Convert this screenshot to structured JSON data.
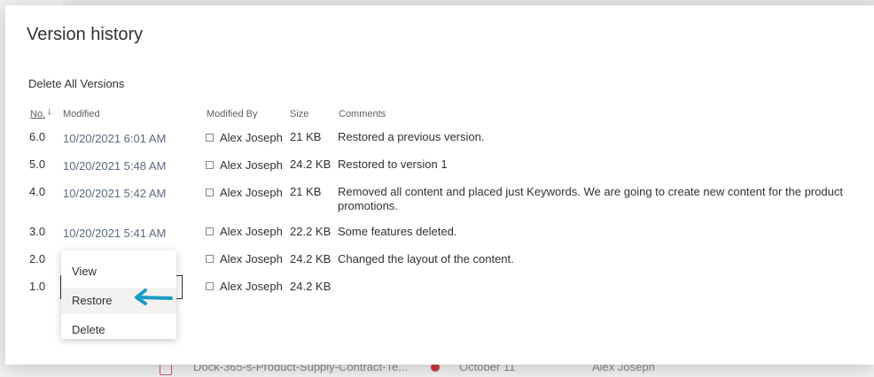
{
  "dialog": {
    "title": "Version history",
    "delete_all_label": "Delete All Versions"
  },
  "columns": {
    "no": "No.",
    "modified": "Modified",
    "modified_by": "Modified By",
    "size": "Size",
    "comments": "Comments"
  },
  "versions": [
    {
      "no": "6.0",
      "modified": "10/20/2021 6:01 AM",
      "modified_by": "Alex Joseph",
      "size": "21 KB",
      "comment": "Restored a previous version."
    },
    {
      "no": "5.0",
      "modified": "10/20/2021 5:48 AM",
      "modified_by": "Alex Joseph",
      "size": "24.2 KB",
      "comment": "Restored to version 1"
    },
    {
      "no": "4.0",
      "modified": "10/20/2021 5:42 AM",
      "modified_by": "Alex Joseph",
      "size": "21 KB",
      "comment": "Removed all content and placed just Keywords. We are going to create new content for the product promotions."
    },
    {
      "no": "3.0",
      "modified": "10/20/2021 5:41 AM",
      "modified_by": "Alex Joseph",
      "size": "22.2 KB",
      "comment": "Some features deleted."
    },
    {
      "no": "2.0",
      "modified": "",
      "modified_by": "Alex Joseph",
      "size": "24.2 KB",
      "comment": "Changed the layout of the content."
    },
    {
      "no": "1.0",
      "modified": "",
      "modified_by": "Alex Joseph",
      "size": "24.2 KB",
      "comment": ""
    }
  ],
  "context_menu": {
    "items": [
      "View",
      "Restore",
      "Delete"
    ],
    "highlighted": "Restore"
  },
  "background_row": {
    "file_name": "Dock-365-s-Product-Supply-Contract-Te...",
    "date": "October 11",
    "author": "Alex Joseph"
  },
  "colors": {
    "annotation_arrow": "#1a9bc4",
    "date_text": "#5a6b80"
  },
  "icons": [
    "sort-down-icon",
    "document-icon",
    "checkout-badge-icon",
    "annotation-arrow-icon"
  ]
}
